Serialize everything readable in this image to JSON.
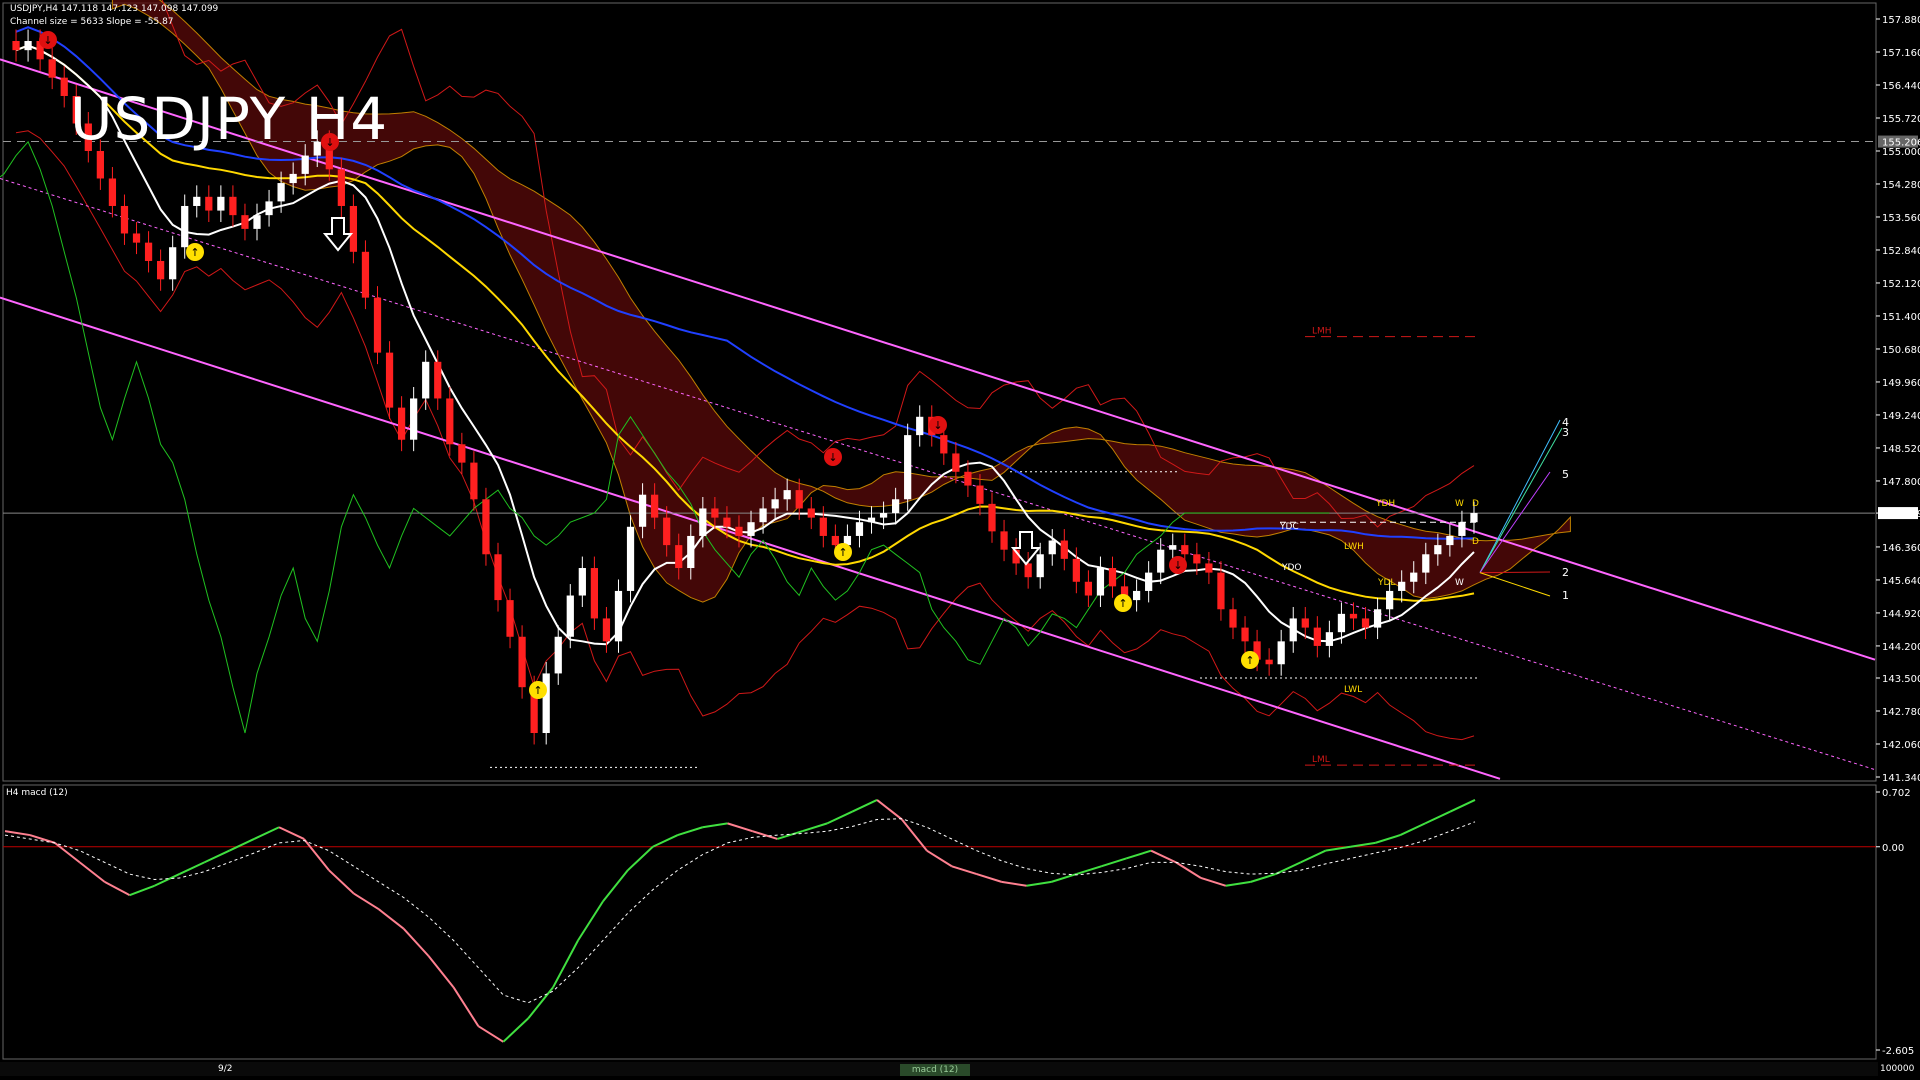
{
  "window": {
    "title": "USDJPY H4",
    "header_line1": "USDJPY,H4  147.118 147.123 147.098 147.099",
    "header_line2": "Channel size = 5633 Slope = -55.87",
    "macd_title": "H4  macd (12)",
    "tab_main": "9/2",
    "tab_macd": "macd (12)",
    "bottom_right_val": "100000"
  },
  "colors": {
    "background": "#000000",
    "bull_candle": "#ffffff",
    "bear_candle": "#ff2020",
    "channel": "#ff66ff",
    "ma_blue": "#2040ff",
    "ma_yellow": "#ffd800",
    "ma_white": "#ffffff",
    "lagging_green": "#20c020",
    "bollinger_red": "#d01818",
    "cloud_red": "#a01010",
    "cloud_blue": "#2040c0",
    "macd_up": "#40e040",
    "macd_down": "#ff8090",
    "macd_signal": "#ffffff",
    "zero_line": "#c00000"
  },
  "price_axis": {
    "ticks": [
      "157.880",
      "157.160",
      "156.440",
      "155.720",
      "155.000",
      "154.280",
      "153.560",
      "152.840",
      "152.120",
      "151.400",
      "150.680",
      "149.960",
      "149.240",
      "148.520",
      "147.800",
      "147.099",
      "146.360",
      "145.640",
      "144.920",
      "144.200",
      "143.500",
      "142.780",
      "142.060",
      "141.340"
    ],
    "current_price": "147.099",
    "hline_price": "155.206"
  },
  "macd_axis": {
    "ticks": [
      "0.702",
      "0.00",
      "-2.605"
    ]
  },
  "level_labels": {
    "LMH": "LMH",
    "LML": "LML",
    "YDH": "YDH",
    "YDC": "YDC",
    "YDO": "YDO",
    "YDL": "YDL",
    "LWH": "LWH",
    "LWL": "LWL",
    "W1": "W",
    "W2": "W",
    "D1": "D",
    "D2": "D"
  },
  "projection_labels": [
    "4",
    "3",
    "5",
    "2",
    "1"
  ],
  "chart_data": {
    "type": "candlestick",
    "symbol": "USDJPY",
    "timeframe": "H4",
    "ylim": [
      141.34,
      158.2
    ],
    "closes": [
      157.2,
      157.4,
      157.0,
      156.6,
      156.2,
      155.6,
      155.0,
      154.4,
      153.8,
      153.2,
      153.0,
      152.6,
      152.2,
      152.9,
      153.8,
      154.0,
      153.7,
      154.0,
      153.6,
      153.3,
      153.6,
      153.9,
      154.3,
      154.5,
      154.9,
      155.2,
      154.6,
      153.8,
      152.8,
      151.8,
      150.6,
      149.4,
      148.7,
      149.6,
      150.4,
      149.6,
      148.6,
      148.2,
      147.4,
      146.2,
      145.2,
      144.4,
      143.3,
      142.3,
      143.6,
      144.4,
      145.3,
      145.9,
      144.8,
      144.3,
      145.4,
      146.8,
      147.5,
      147.0,
      146.4,
      145.9,
      146.6,
      147.2,
      147.0,
      146.8,
      146.6,
      146.9,
      147.2,
      147.4,
      147.6,
      147.2,
      147.0,
      146.6,
      146.4,
      146.6,
      146.9,
      147.0,
      147.1,
      147.4,
      148.8,
      149.2,
      148.8,
      148.4,
      148.0,
      147.7,
      147.3,
      146.7,
      146.3,
      146.0,
      145.7,
      146.2,
      146.5,
      146.1,
      145.6,
      145.3,
      145.9,
      145.5,
      145.2,
      145.4,
      145.8,
      146.3,
      146.4,
      146.2,
      146.0,
      145.8,
      145.0,
      144.6,
      144.3,
      143.9,
      143.8,
      144.3,
      144.8,
      144.6,
      144.2,
      144.5,
      144.9,
      144.8,
      144.6,
      145.0,
      145.4,
      145.6,
      145.8,
      146.2,
      146.4,
      146.6,
      146.9,
      147.1
    ],
    "macd": [
      0.2,
      0.15,
      0.05,
      -0.2,
      -0.45,
      -0.62,
      -0.5,
      -0.35,
      -0.2,
      -0.05,
      0.1,
      0.25,
      0.1,
      -0.3,
      -0.6,
      -0.8,
      -1.05,
      -1.4,
      -1.8,
      -2.3,
      -2.5,
      -2.2,
      -1.8,
      -1.2,
      -0.7,
      -0.3,
      0.0,
      0.15,
      0.25,
      0.3,
      0.2,
      0.1,
      0.2,
      0.3,
      0.45,
      0.6,
      0.35,
      -0.05,
      -0.25,
      -0.35,
      -0.45,
      -0.5,
      -0.45,
      -0.35,
      -0.25,
      -0.15,
      -0.05,
      -0.2,
      -0.4,
      -0.5,
      -0.45,
      -0.35,
      -0.2,
      -0.05,
      0.0,
      0.05,
      0.15,
      0.3,
      0.45,
      0.6
    ],
    "macd_signal": [
      0.15,
      0.1,
      0.05,
      -0.05,
      -0.2,
      -0.35,
      -0.42,
      -0.4,
      -0.32,
      -0.2,
      -0.08,
      0.05,
      0.08,
      -0.05,
      -0.25,
      -0.45,
      -0.65,
      -0.9,
      -1.2,
      -1.55,
      -1.9,
      -2.0,
      -1.85,
      -1.55,
      -1.2,
      -0.85,
      -0.55,
      -0.3,
      -0.1,
      0.05,
      0.12,
      0.15,
      0.17,
      0.2,
      0.26,
      0.35,
      0.36,
      0.25,
      0.1,
      -0.05,
      -0.18,
      -0.28,
      -0.34,
      -0.36,
      -0.33,
      -0.28,
      -0.2,
      -0.2,
      -0.25,
      -0.32,
      -0.35,
      -0.34,
      -0.3,
      -0.22,
      -0.15,
      -0.08,
      -0.01,
      0.08,
      0.2,
      0.32
    ],
    "macd_ylim": [
      -2.605,
      0.702
    ]
  }
}
